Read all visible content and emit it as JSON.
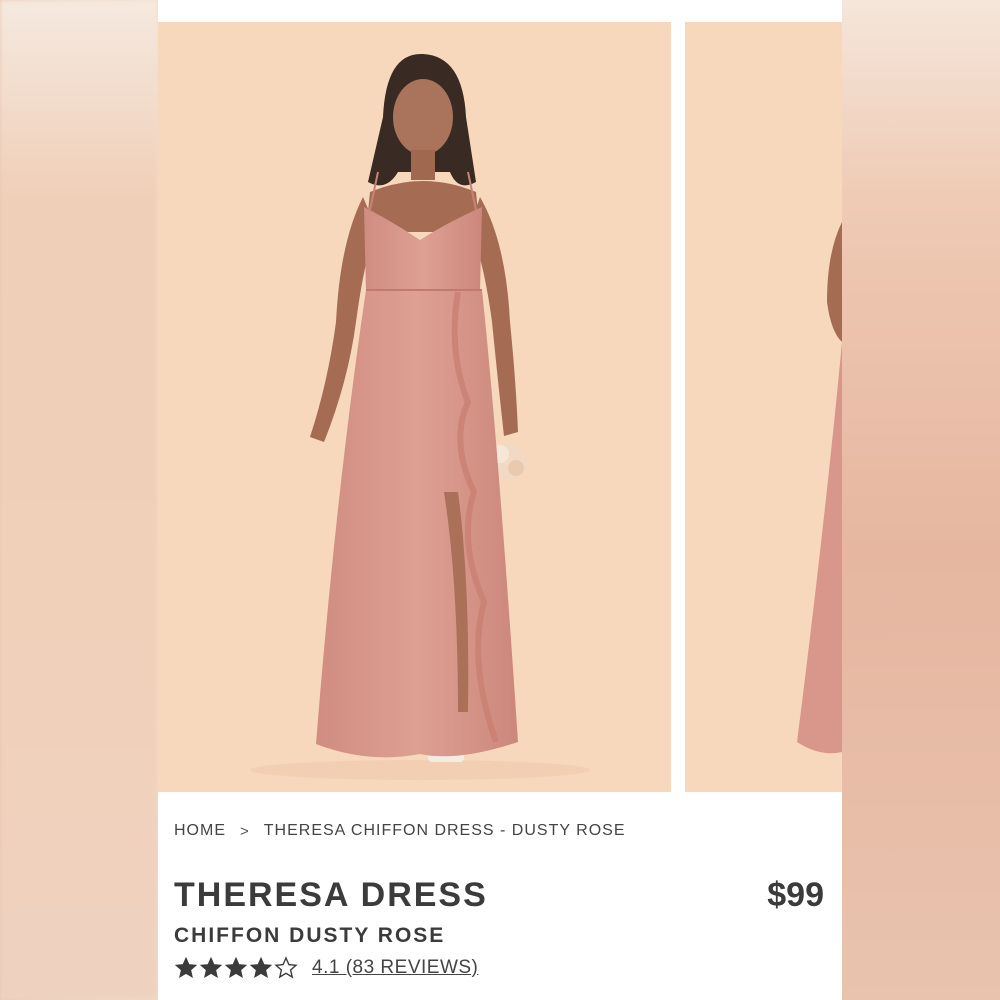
{
  "breadcrumb": {
    "home": "HOME",
    "separator": ">",
    "current": "THERESA CHIFFON DRESS - DUSTY ROSE"
  },
  "product": {
    "title": "THERESA DRESS",
    "subtitle": "CHIFFON DUSTY ROSE",
    "price": "$99",
    "rating_value": 4.1,
    "rating_max": 5,
    "reviews_label": "4.1 (83 REVIEWS)"
  },
  "icons": {
    "star_filled": "star-filled-icon",
    "star_empty": "star-outline-icon",
    "breadcrumb_separator": "chevron-right-icon"
  },
  "colors": {
    "dress": "#d9978a",
    "backdrop": "#f7d8bd",
    "text": "#3b3b3b"
  }
}
